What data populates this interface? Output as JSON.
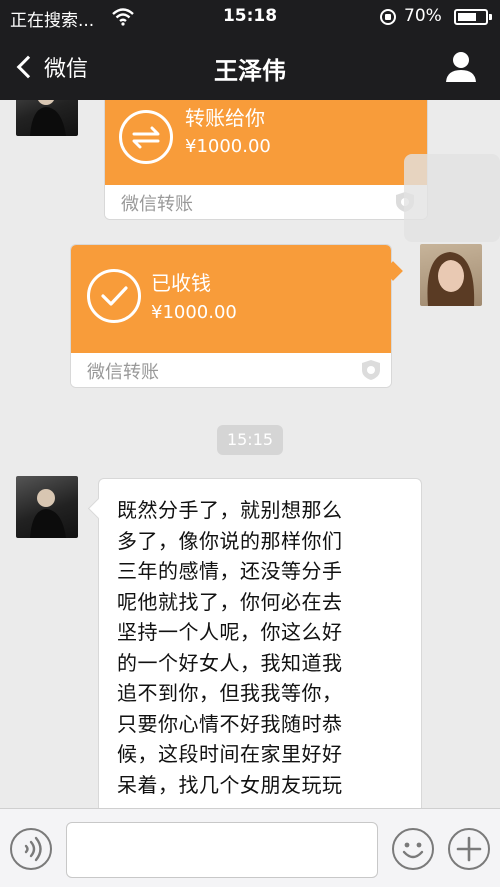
{
  "status_bar": {
    "carrier": "正在搜索...",
    "time": "15:18",
    "battery": "70%",
    "battery_level": 0.7
  },
  "nav": {
    "back_label": "微信",
    "title": "王泽伟",
    "profile_icon": "person-icon"
  },
  "messages": [
    {
      "type": "transfer",
      "sender": "contact",
      "title": "转账给你",
      "amount": "¥1000.00",
      "footer": "微信转账",
      "icon": "transfer-arrows-icon"
    },
    {
      "type": "transfer",
      "sender": "me",
      "title": "已收钱",
      "amount": "¥1000.00",
      "footer": "微信转账",
      "icon": "checkmark-icon"
    },
    {
      "type": "timestamp",
      "text": "15:15"
    },
    {
      "type": "text",
      "sender": "contact",
      "lines": [
        "既然分手了，就别想那么",
        "多了，像你说的那样你们",
        "三年的感情，还没等分手",
        "呢他就找了，你何必在去",
        "坚持一个人呢，你这么好",
        "的一个好女人，我知道我",
        "追不到你，但我我等你，",
        "只要你心情不好我随时恭",
        "候，这段时间在家里好好",
        "呆着，找几个女朋友玩玩"
      ]
    }
  ],
  "input_bar": {
    "voice_icon": "voice-icon",
    "emoji_icon": "emoji-icon",
    "plus_icon": "plus-icon",
    "placeholder": ""
  },
  "colors": {
    "transfer_orange": "#f89c3a",
    "bar_dark": "#1d1d1f",
    "chat_bg": "#ebebeb"
  }
}
